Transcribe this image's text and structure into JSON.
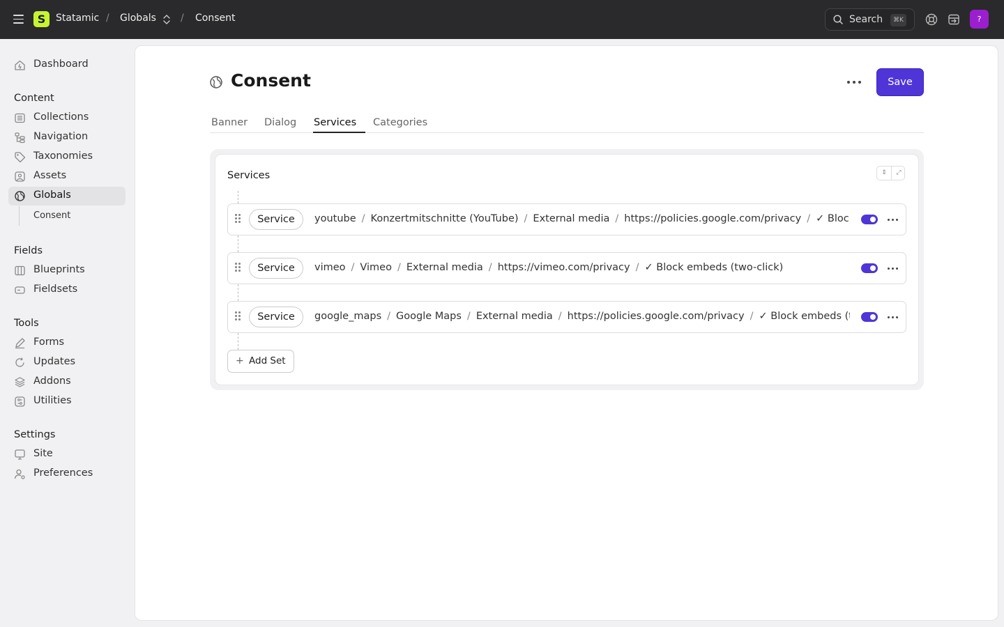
{
  "topbar": {
    "brand": "Statamic",
    "logo_letter": "S",
    "breadcrumbs": [
      "Globals",
      "Consent"
    ],
    "separator": "/",
    "search_label": "Search",
    "search_shortcut": "⌘K",
    "avatar_initial": "?"
  },
  "sidebar": {
    "dashboard": "Dashboard",
    "sections": {
      "content": "Content",
      "fields": "Fields",
      "tools": "Tools",
      "settings": "Settings"
    },
    "items": {
      "collections": "Collections",
      "navigation": "Navigation",
      "taxonomies": "Taxonomies",
      "assets": "Assets",
      "globals": "Globals",
      "consent": "Consent",
      "blueprints": "Blueprints",
      "fieldsets": "Fieldsets",
      "forms": "Forms",
      "updates": "Updates",
      "addons": "Addons",
      "utilities": "Utilities",
      "site": "Site",
      "preferences": "Preferences"
    },
    "active_item": "Globals"
  },
  "page": {
    "title": "Consent",
    "save_label": "Save",
    "tabs": [
      "Banner",
      "Dialog",
      "Services",
      "Categories"
    ],
    "active_tab": "Services"
  },
  "services": {
    "title": "Services",
    "add_set_label": "Add Set",
    "set_label": "Service",
    "rows": [
      {
        "handle": "youtube",
        "name": "Konzertmitschnitte (YouTube)",
        "category": "External media",
        "url": "https://policies.google.com/privacy",
        "embed": "✓ Block embeds (two-click)",
        "enabled": true
      },
      {
        "handle": "vimeo",
        "name": "Vimeo",
        "category": "External media",
        "url": "https://vimeo.com/privacy",
        "embed": "✓ Block embeds (two-click)",
        "enabled": true
      },
      {
        "handle": "google_maps",
        "name": "Google Maps",
        "category": "External media",
        "url": "https://policies.google.com/privacy",
        "embed": "✓ Block embeds (two-click)",
        "enabled": true
      }
    ]
  },
  "colors": {
    "accent": "#4f35d8",
    "topbar": "#2a2a2c",
    "logo": "#c6f432",
    "avatar": "#9b1fcf"
  }
}
